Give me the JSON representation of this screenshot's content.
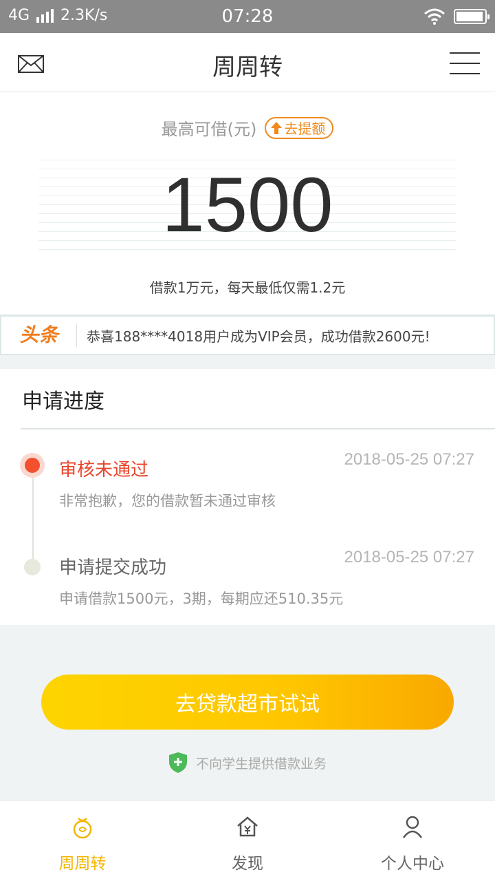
{
  "status_bar": {
    "network": "4G",
    "speed": "2.3K/s",
    "time": "07:28"
  },
  "header": {
    "title": "周周转"
  },
  "amount": {
    "label": "最高可借(元)",
    "raise_label": "去提额",
    "value": "1500",
    "note": "借款1万元，每天最低仅需1.2元"
  },
  "ticker": {
    "logo": "头条",
    "text": "恭喜188****4018用户成为VIP会员，成功借款2600元!"
  },
  "progress": {
    "title": "申请进度",
    "steps": [
      {
        "title": "审核未通过",
        "desc": "非常抱歉，您的借款暂未通过审核",
        "time": "2018-05-25 07:27",
        "color": "#e8452b"
      },
      {
        "title": "申请提交成功",
        "desc": "申请借款1500元，3期，每期应还510.35元",
        "time": "2018-05-25 07:27",
        "color": "#666666"
      }
    ]
  },
  "cta": {
    "label": "去贷款超市试试"
  },
  "notice": {
    "text": "不向学生提供借款业务"
  },
  "tabs": [
    {
      "label": "周周转",
      "icon": "gift-icon",
      "active": true
    },
    {
      "label": "发现",
      "icon": "home-yen-icon",
      "active": false
    },
    {
      "label": "个人中心",
      "icon": "user-icon",
      "active": false
    }
  ],
  "colors": {
    "accent": "#f5b400",
    "orange": "#f08a1e",
    "error": "#e8452b"
  }
}
